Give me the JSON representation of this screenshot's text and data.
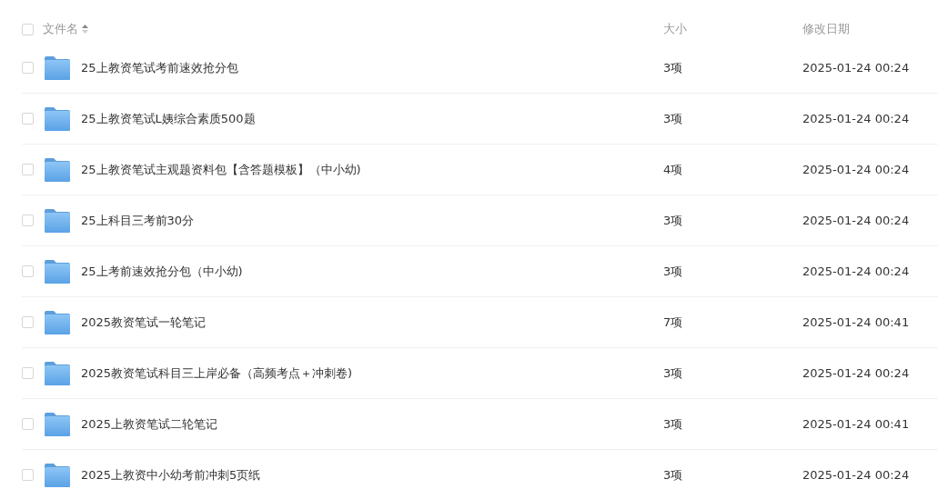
{
  "header": {
    "checked": false,
    "columns": [
      {
        "label": "文件名",
        "sortable": true
      },
      {
        "label": "大小",
        "sortable": false
      },
      {
        "label": "修改日期",
        "sortable": false
      }
    ]
  },
  "rows": [
    {
      "kind": "folder",
      "name": "25上教资笔试考前速效抢分包",
      "size": "3项",
      "modified": "2025-01-24 00:24",
      "checked": false
    },
    {
      "kind": "folder",
      "name": "25上教资笔试L姨综合素质500题",
      "size": "3项",
      "modified": "2025-01-24 00:24",
      "checked": false
    },
    {
      "kind": "folder",
      "name": "25上教资笔试主观题资料包【含答题模板】（中小幼)",
      "size": "4项",
      "modified": "2025-01-24 00:24",
      "checked": false
    },
    {
      "kind": "folder",
      "name": "25上科目三考前30分",
      "size": "3项",
      "modified": "2025-01-24 00:24",
      "checked": false
    },
    {
      "kind": "folder",
      "name": "25上考前速效抢分包（中小幼)",
      "size": "3项",
      "modified": "2025-01-24 00:24",
      "checked": false
    },
    {
      "kind": "folder",
      "name": "2025教资笔试一轮笔记",
      "size": "7项",
      "modified": "2025-01-24 00:41",
      "checked": false
    },
    {
      "kind": "folder",
      "name": "2025教资笔试科目三上岸必备（高频考点＋冲刺卷)",
      "size": "3项",
      "modified": "2025-01-24 00:24",
      "checked": false
    },
    {
      "kind": "folder",
      "name": "2025上教资笔试二轮笔记",
      "size": "3项",
      "modified": "2025-01-24 00:41",
      "checked": false
    },
    {
      "kind": "folder",
      "name": "2025上教资中小幼考前冲刺5页纸",
      "size": "3项",
      "modified": "2025-01-24 00:24",
      "checked": false
    }
  ]
}
